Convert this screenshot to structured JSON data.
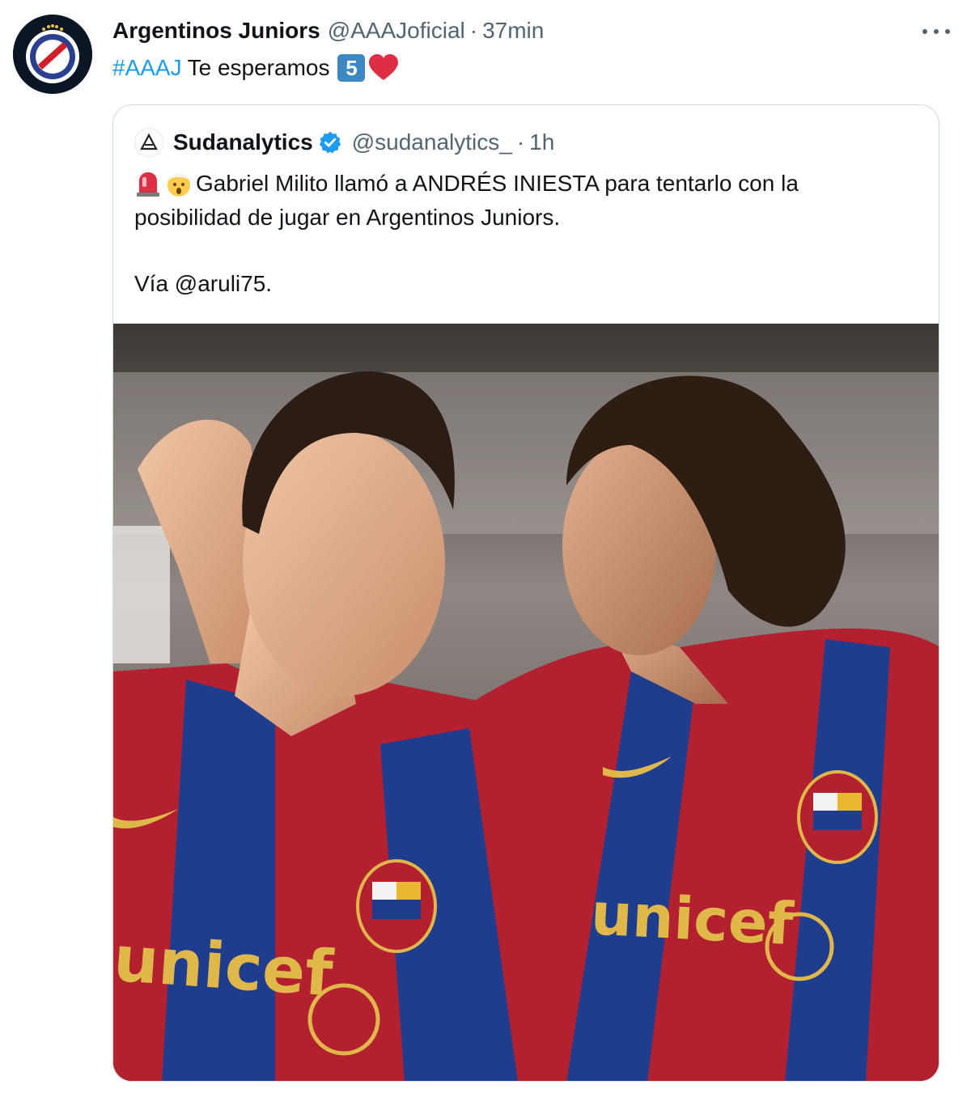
{
  "tweet": {
    "display_name": "Argentinos Juniors",
    "handle": "@AAAJoficial",
    "separator": "·",
    "time": "37min",
    "hashtag": "#AAAJ",
    "text": "Te esperamos",
    "keycap": "5",
    "avatar_icon": "argentinos-juniors-crest-icon"
  },
  "quote": {
    "display_name": "Sudanalytics",
    "handle": "@sudanalytics_",
    "separator": "·",
    "time": "1h",
    "verified": true,
    "text_line1": "Gabriel Milito llamó a ANDRÉS INIESTA para tentarlo con la",
    "text_line2": "posibilidad de jugar en Argentinos Juniors.",
    "via": "Vía @aruli75.",
    "media_caption": "Two FC Barcelona players in blue and red unicef kits"
  },
  "colors": {
    "link": "#1d9bf0",
    "secondary_text": "#536471",
    "border": "#cfd9de",
    "verified_badge": "#1d9bf0",
    "heart": "#dd2e44"
  }
}
